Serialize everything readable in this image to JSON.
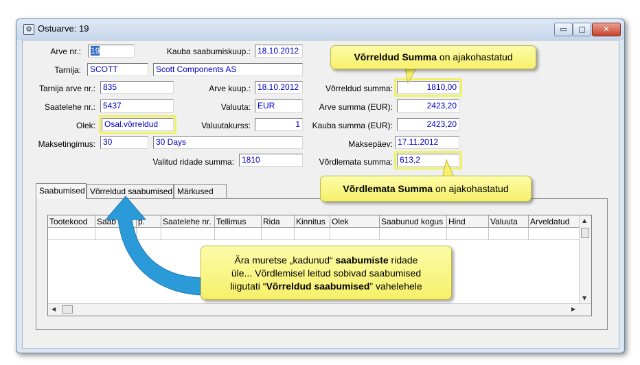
{
  "window": {
    "title": "Ostuarve: 19",
    "min": "▭",
    "max": "□",
    "close": "✕"
  },
  "form": {
    "arve_nr_label": "Arve nr.:",
    "arve_nr": "19",
    "kauba_saabumiskuup_label": "Kauba saabumiskuup.:",
    "kauba_saabumiskuup": "18.10.2012",
    "tarnija_label": "Tarnija:",
    "tarnija_code": "SCOTT",
    "tarnija_name": "Scott Components AS",
    "tarnija_arve_nr_label": "Tarnija arve nr.:",
    "tarnija_arve_nr": "835",
    "arve_kuup_label": "Arve kuup.:",
    "arve_kuup": "18.10.2012",
    "vorreldud_summa_label": "Võrreldud summa:",
    "vorreldud_summa": "1810,00",
    "saatelehe_nr_label": "Saatelehe nr.:",
    "saatelehe_nr": "5437",
    "valuuta_label": "Valuuta:",
    "valuuta": "EUR",
    "arve_summa_label": "Arve summa (EUR):",
    "arve_summa": "2423,20",
    "olek_label": "Olek:",
    "olek": "Osal.võrreldud",
    "valuutakurss_label": "Valuutakurss:",
    "valuutakurss": "1",
    "kauba_summa_label": "Kauba summa (EUR):",
    "kauba_summa": "2423,20",
    "maksetingimus_label": "Maksetingimus:",
    "maksetingimus_code": "30",
    "maksetingimus_name": "30 Days",
    "maksepaev_label": "Maksepäev:",
    "maksepaev": "17.11.2012",
    "valitud_ridade_summa_label": "Valitud ridade summa:",
    "valitud_ridade_summa": "1810",
    "vordlemata_summa_label": "Võrdlemata summa:",
    "vordlemata_summa": "613,2"
  },
  "tabs": [
    "Saabumised",
    "Võrreldud saabumised",
    "Märkused"
  ],
  "grid": {
    "columns": [
      "Tootekood",
      "Saab",
      "p.",
      "Saatelehe nr.",
      "Tellimus",
      "Rida",
      "Kinnitus",
      "Olek",
      "Saabunud kogus",
      "Hind",
      "Valuuta",
      "Arveldatud"
    ]
  },
  "callouts": {
    "top_bold": "Võrreldud Summa",
    "top_rest": " on ajakohastatud",
    "bottom_bold": "Võrdlemata Summa",
    "bottom_rest": " on ajakohastatud",
    "center_l1_a": "Ära muretse „kadunud“ ",
    "center_l1_b": "saabumiste",
    "center_l1_c": " ridade",
    "center_l2": "üle... Võrdlemisel leitud sobivad saabumised",
    "center_l3_a": "liigutati “",
    "center_l3_b": "Võrreldud saabumised",
    "center_l3_c": "” vahelehele"
  },
  "colors": {
    "highlight": "#eef264",
    "callout": "#f6f06a",
    "arrow": "#2a9ad8"
  }
}
